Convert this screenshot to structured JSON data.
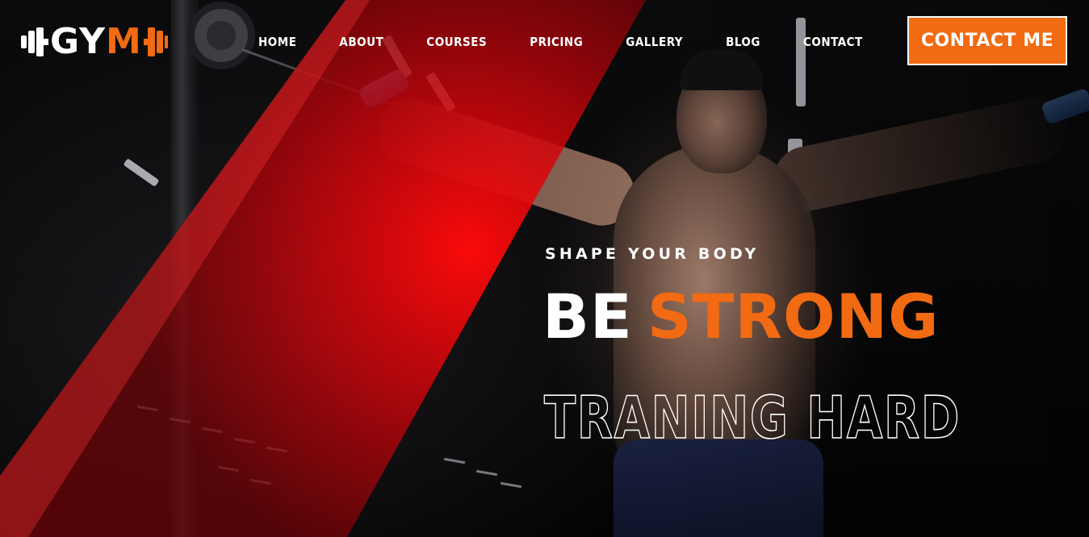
{
  "brand": {
    "logo_prefix": "GY",
    "logo_accent": "M",
    "accent_color": "#f26a12",
    "band_color": "#e30613"
  },
  "nav": {
    "items": [
      {
        "label": "HOME"
      },
      {
        "label": "ABOUT"
      },
      {
        "label": "COURSES"
      },
      {
        "label": "PRICING"
      },
      {
        "label": "GALLERY"
      },
      {
        "label": "BLOG"
      },
      {
        "label": "CONTACT"
      }
    ]
  },
  "cta": {
    "label": "CONTACT ME"
  },
  "hero": {
    "tagline": "SHAPE YOUR BODY",
    "headline_white": "BE",
    "headline_accent": "STRONG",
    "outline_title": "TRANING HARD"
  },
  "icons": {
    "logo_left": "dumbbell-plate-icon",
    "logo_right": "dumbbell-plate-icon"
  }
}
